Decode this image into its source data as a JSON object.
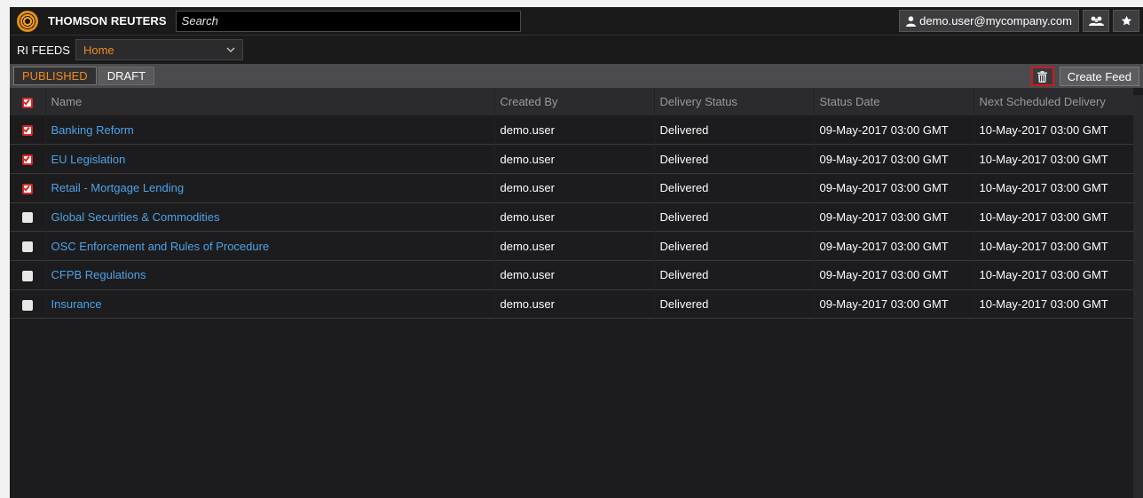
{
  "topbar": {
    "brand": "THOMSON REUTERS",
    "search_placeholder": "Search",
    "user_label": "demo.user@mycompany.com"
  },
  "feeds": {
    "label": "RI FEEDS",
    "selected": "Home"
  },
  "tabs": [
    {
      "label": "PUBLISHED",
      "active": true
    },
    {
      "label": "DRAFT",
      "active": false
    }
  ],
  "actions": {
    "create_label": "Create Feed"
  },
  "table": {
    "columns": [
      "Name",
      "Created By",
      "Delivery Status",
      "Status Date",
      "Next Scheduled Delivery"
    ],
    "rows": [
      {
        "checked": true,
        "name": "Banking Reform",
        "created_by": "demo.user",
        "status": "Delivered",
        "status_date": "09-May-2017 03:00 GMT",
        "next": "10-May-2017 03:00 GMT"
      },
      {
        "checked": true,
        "name": "EU Legislation",
        "created_by": "demo.user",
        "status": "Delivered",
        "status_date": "09-May-2017 03:00 GMT",
        "next": "10-May-2017 03:00 GMT"
      },
      {
        "checked": true,
        "name": "Retail - Mortgage Lending",
        "created_by": "demo.user",
        "status": "Delivered",
        "status_date": "09-May-2017 03:00 GMT",
        "next": "10-May-2017 03:00 GMT"
      },
      {
        "checked": false,
        "name": "Global Securities & Commodities",
        "created_by": "demo.user",
        "status": "Delivered",
        "status_date": "09-May-2017 03:00 GMT",
        "next": "10-May-2017 03:00 GMT"
      },
      {
        "checked": false,
        "name": "OSC Enforcement and Rules of Procedure",
        "created_by": "demo.user",
        "status": "Delivered",
        "status_date": "09-May-2017 03:00 GMT",
        "next": "10-May-2017 03:00 GMT"
      },
      {
        "checked": false,
        "name": "CFPB Regulations",
        "created_by": "demo.user",
        "status": "Delivered",
        "status_date": "09-May-2017 03:00 GMT",
        "next": "10-May-2017 03:00 GMT"
      },
      {
        "checked": false,
        "name": "Insurance",
        "created_by": "demo.user",
        "status": "Delivered",
        "status_date": "09-May-2017 03:00 GMT",
        "next": "10-May-2017 03:00 GMT"
      }
    ]
  },
  "icons": {
    "logo": "thomson-reuters-logo",
    "user": "user-icon",
    "people": "people-icon",
    "star": "star-icon",
    "trash": "trash-icon",
    "chevron": "chevron-down-icon"
  },
  "colors": {
    "accent": "#f08a1c",
    "link": "#4ea2e6",
    "check": "#d82727",
    "highlight_border": "#d0181c"
  }
}
